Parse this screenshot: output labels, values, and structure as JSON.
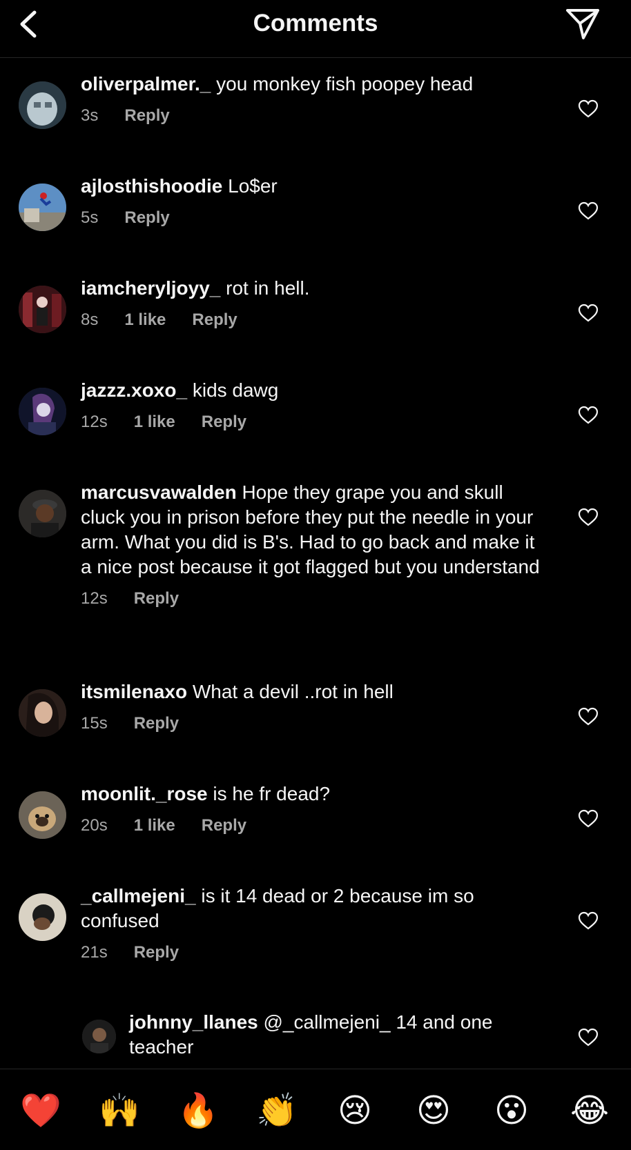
{
  "header": {
    "title": "Comments"
  },
  "comments": [
    {
      "username": "oliverpalmer._",
      "text": "you monkey fish poopey head",
      "time": "3s",
      "likes": "",
      "reply": "Reply"
    },
    {
      "username": "ajlosthishoodie",
      "text": "Lo$er",
      "time": "5s",
      "likes": "",
      "reply": "Reply"
    },
    {
      "username": "iamcheryljoyy_",
      "text": "rot in hell.",
      "time": "8s",
      "likes": "1 like",
      "reply": "Reply"
    },
    {
      "username": "jazzz.xoxo_",
      "text": "kids dawg",
      "time": "12s",
      "likes": "1 like",
      "reply": "Reply"
    },
    {
      "username": "marcusvawalden",
      "text": "Hope they grape you and skull cluck you in prison before they put the needle in your arm. What you did is B's. Had to go back and make it a nice post because it got flagged but you understand",
      "time": "12s",
      "likes": "",
      "reply": "Reply"
    },
    {
      "username": "itsmilenaxo",
      "text": "What a devil ..rot in hell",
      "time": "15s",
      "likes": "",
      "reply": "Reply"
    },
    {
      "username": "moonlit._rose",
      "text": "is he fr dead?",
      "time": "20s",
      "likes": "1 like",
      "reply": "Reply"
    },
    {
      "username": "_callmejeni_",
      "text": "is it 14 dead or 2 because im so confused",
      "time": "21s",
      "likes": "",
      "reply": "Reply"
    },
    {
      "username": "johnny_llanes",
      "text": "@_callmejeni_ 14 and one teacher"
    }
  ],
  "emojis": [
    "❤️",
    "🙌",
    "🔥",
    "👏",
    "😢",
    "😍",
    "😮",
    "😂"
  ]
}
